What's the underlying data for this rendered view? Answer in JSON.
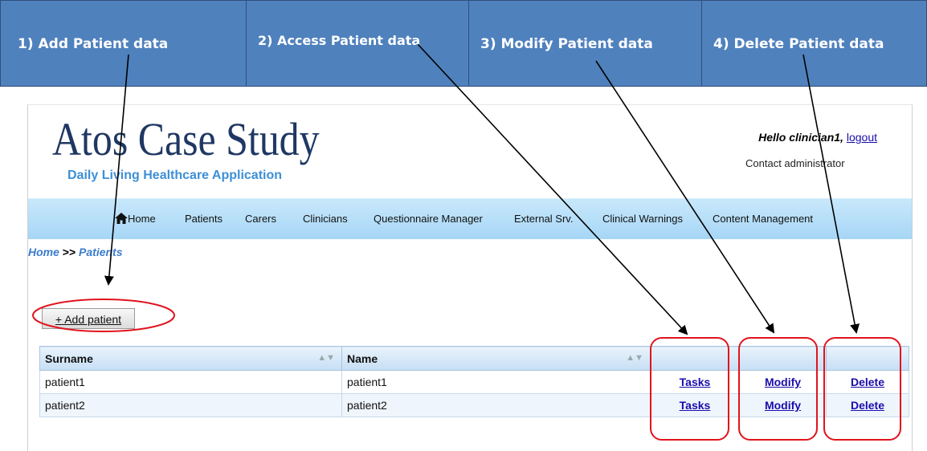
{
  "steps": [
    {
      "label": "1) Add Patient data"
    },
    {
      "label": "2) Access Patient data"
    },
    {
      "label": "3) Modify Patient data"
    },
    {
      "label": "4) Delete Patient data"
    }
  ],
  "app": {
    "title": "Atos Case Study",
    "subtitle": "Daily Living Healthcare Application",
    "greeting": "Hello clinician1,",
    "logout": "logout",
    "contact": "Contact administrator"
  },
  "nav": {
    "home": "Home",
    "patients": "Patients",
    "carers": "Carers",
    "clinicians": "Clinicians",
    "questionnaire": "Questionnaire Manager",
    "external": "External Srv.",
    "warnings": "Clinical Warnings",
    "content": "Content Management"
  },
  "breadcrumb": {
    "home": "Home",
    "sep": ">>",
    "current": "Patients"
  },
  "add_button": "+ Add patient",
  "table": {
    "headers": {
      "surname": "Surname",
      "name": "Name"
    },
    "rows": [
      {
        "surname": "patient1",
        "name": "patient1",
        "tasks": "Tasks",
        "modify": "Modify",
        "delete": "Delete"
      },
      {
        "surname": "patient2",
        "name": "patient2",
        "tasks": "Tasks",
        "modify": "Modify",
        "delete": "Delete"
      }
    ]
  },
  "colors": {
    "banner": "#4f81bd",
    "highlight": "#e0141e",
    "nav": "#b6dcf7"
  }
}
